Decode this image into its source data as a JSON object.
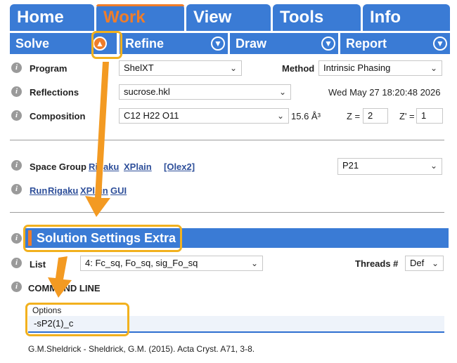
{
  "tabs": [
    {
      "label": "Home"
    },
    {
      "label": "Work"
    },
    {
      "label": "View"
    },
    {
      "label": "Tools"
    },
    {
      "label": "Info"
    }
  ],
  "subtabs": [
    {
      "label": "Solve",
      "icon": "up-arrow-circle-icon"
    },
    {
      "label": "Refine",
      "icon": "down-arrow-circle-icon"
    },
    {
      "label": "Draw",
      "icon": "down-arrow-circle-icon"
    },
    {
      "label": "Report",
      "icon": "down-arrow-circle-icon"
    }
  ],
  "program": {
    "label": "Program",
    "value": "ShelXT"
  },
  "method": {
    "label": "Method",
    "value": "Intrinsic Phasing"
  },
  "reflections": {
    "label": "Reflections",
    "value": "sucrose.hkl",
    "timestamp": "Wed May 27 18:20:48 2026"
  },
  "composition": {
    "label": "Composition",
    "value": "C12 H22 O11",
    "volume": "15.6 Å³",
    "z_label": "Z =",
    "z_value": "2",
    "zp_label": "Z' =",
    "zp_value": "1"
  },
  "spacegroup": {
    "label": "Space Group",
    "links": [
      "Rigaku",
      "XPlain",
      "[Olex2]"
    ],
    "value": "P21"
  },
  "run": {
    "links": [
      "Run",
      "Rigaku",
      "XPlain",
      "GUI"
    ]
  },
  "section": {
    "title": "Solution Settings Extra"
  },
  "list": {
    "label": "List",
    "value": "4: Fc_sq, Fo_sq, sig_Fo_sq"
  },
  "threads": {
    "label": "Threads #",
    "value": "Def"
  },
  "command_line": {
    "label": "COMMAND LINE"
  },
  "options": {
    "label": "Options",
    "value": "-sP2(1)_c"
  },
  "citation": "G.M.Sheldrick - Sheldrick, G.M. (2015). Acta Cryst. A71, 3-8.",
  "colors": {
    "tab_blue": "#3a7bd5",
    "accent_orange": "#ef7d2a",
    "highlight_yellow": "#f2b11e"
  }
}
